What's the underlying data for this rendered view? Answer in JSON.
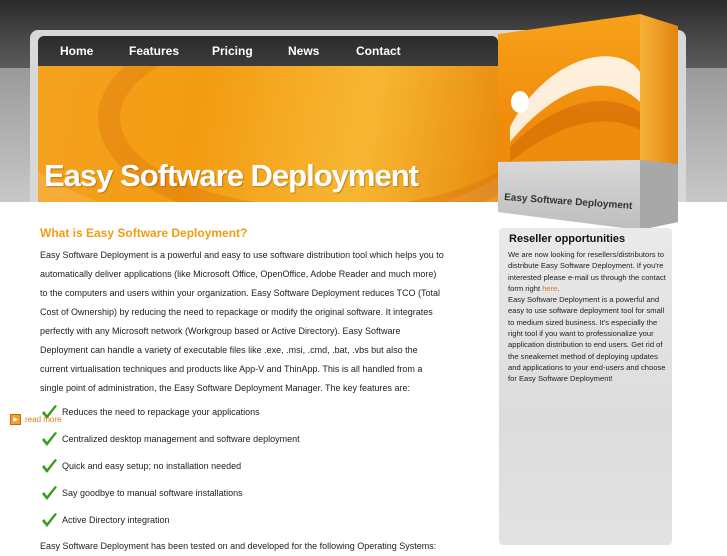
{
  "nav": {
    "items": [
      {
        "label": "Home"
      },
      {
        "label": "Features"
      },
      {
        "label": "Pricing"
      },
      {
        "label": "News"
      },
      {
        "label": "Contact"
      }
    ]
  },
  "hero": {
    "title": "Easy Software Deployment"
  },
  "product_box": {
    "label": "Easy Software Deployment"
  },
  "main": {
    "heading": "What is Easy Software Deployment?",
    "intro": "Easy Software Deployment is a powerful and easy to use software distribution tool which helps you to automatically deliver applications (like Microsoft Office, OpenOffice, Adobe Reader and much more) to the computers and users within your organization. Easy Software Deployment reduces TCO (Total Cost of Ownership) by reducing the need to repackage or modify the original software. It integrates perfectly with any Microsoft network (Workgroup based or Active Directory). Easy Software Deployment can handle a variety of executable files like .exe, .msi, .cmd, .bat, .vbs but also the current virtualisation techniques and products like App-V and ThinApp. This is all handled from a single point of administration, the Easy Software Deployment Manager. The key features are:",
    "features": [
      "Reduces the need to repackage your applications",
      "Centralized desktop management and software deployment",
      "Quick and easy setup; no installation needed",
      "Say goodbye to manual software installations",
      "Active Directory integration"
    ],
    "tail": "Easy Software Deployment has been tested on and developed for the following Operating Systems:"
  },
  "sidebar": {
    "title": "Reseller opportunities",
    "text_before_link": "We are now looking for resellers/distributors to distribute Easy Software Deployment. If you're interested please e-mail us through the contact form right ",
    "link_label": "here",
    "text_after_link": ".",
    "text2": "Easy Software Deployment is a powerful and easy to use software deployment tool for small to medium sized business. It's especially the right tool if you want to professionalize your application distribution to end users. Get rid of the sneakernet method of deploying updates and applications to your end-users and choose for Easy Software Deployment!",
    "read_more": "read more"
  },
  "colors": {
    "accent": "#f39c12",
    "nav_bg": "#2b2b2b",
    "check": "#3a9a1a"
  }
}
